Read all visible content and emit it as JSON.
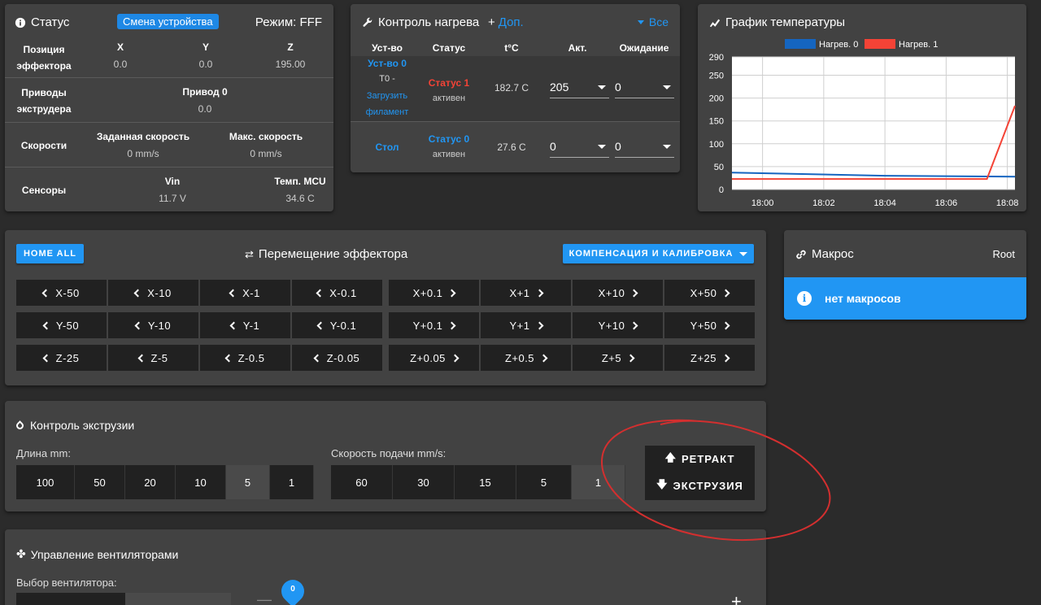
{
  "status": {
    "title": "Статус",
    "device_change": "Смена устройства",
    "mode": "Режим: FFF",
    "position_label_1": "Позиция",
    "position_label_2": "эффектора",
    "axes": [
      {
        "name": "X",
        "value": "0.0"
      },
      {
        "name": "Y",
        "value": "0.0"
      },
      {
        "name": "Z",
        "value": "195.00"
      }
    ],
    "drives_label_1": "Приводы",
    "drives_label_2": "экструдера",
    "drive0_name": "Привод 0",
    "drive0_value": "0.0",
    "speeds_label": "Скорости",
    "req_speed_name": "Заданная скорость",
    "req_speed_value": "0 mm/s",
    "max_speed_name": "Макс. скорость",
    "max_speed_value": "0 mm/s",
    "sensors_label": "Сенсоры",
    "vin_name": "Vin",
    "vin_value": "11.7 V",
    "mcu_name": "Темп. MCU",
    "mcu_value": "34.6 C"
  },
  "heater": {
    "title": "Контроль нагрева",
    "extra": "Доп.",
    "all": "Все",
    "columns": [
      "Уст-во",
      "Статус",
      "t°C",
      "Акт.",
      "Ожидание"
    ],
    "tool": {
      "name": "Уст-во 0",
      "sub": "T0 -",
      "load_1": "Загрузить",
      "load_2": "филамент",
      "status": "Статус 1",
      "state": "активен",
      "temp": "182.7 C",
      "active": "205",
      "standby": "0"
    },
    "bed": {
      "name": "Стол",
      "status": "Статус 0",
      "state": "активен",
      "temp": "27.6 C",
      "active": "0",
      "standby": "0"
    }
  },
  "graph": {
    "title": "График температуры"
  },
  "chart_data": {
    "type": "line",
    "title": "",
    "xlabel": "",
    "ylabel": "",
    "x_ticks": [
      "18:00",
      "18:02",
      "18:04",
      "18:06",
      "18:08"
    ],
    "y_ticks": [
      0,
      50,
      100,
      150,
      200,
      250,
      290
    ],
    "ylim": [
      0,
      290
    ],
    "xlim": [
      "17:59:00",
      "18:08:15"
    ],
    "grid": true,
    "legend_position": "top-center",
    "series": [
      {
        "name": "Нагрев. 0",
        "color": "#1565c0",
        "x": [
          "17:59:00",
          "18:04:00",
          "18:08:15"
        ],
        "y": [
          37,
          30,
          28
        ]
      },
      {
        "name": "Нагрев. 1",
        "color": "#f44336",
        "x": [
          "17:59:00",
          "18:07:20",
          "18:08:15"
        ],
        "y": [
          23,
          23,
          183
        ]
      }
    ]
  },
  "move": {
    "home_all": "HOME ALL",
    "title": "Перемещение эффектора",
    "compensation": "КОМПЕНСАЦИЯ И КАЛИБРОВКА",
    "rows": [
      {
        "neg": [
          "X-50",
          "X-10",
          "X-1",
          "X-0.1"
        ],
        "pos": [
          "X+0.1",
          "X+1",
          "X+10",
          "X+50"
        ]
      },
      {
        "neg": [
          "Y-50",
          "Y-10",
          "Y-1",
          "Y-0.1"
        ],
        "pos": [
          "Y+0.1",
          "Y+1",
          "Y+10",
          "Y+50"
        ]
      },
      {
        "neg": [
          "Z-25",
          "Z-5",
          "Z-0.5",
          "Z-0.05"
        ],
        "pos": [
          "Z+0.05",
          "Z+0.5",
          "Z+5",
          "Z+25"
        ]
      }
    ]
  },
  "macros": {
    "title": "Макрос",
    "root": "Root",
    "empty": "нет макросов"
  },
  "extrusion": {
    "title": "Контроль экструзии",
    "length_label": "Длина mm:",
    "lengths": [
      "100",
      "50",
      "20",
      "10",
      "5",
      "1"
    ],
    "length_selected": "5",
    "feed_label": "Скорость подачи mm/s:",
    "feeds": [
      "60",
      "30",
      "15",
      "5",
      "1"
    ],
    "feed_selected": "1",
    "retract": "РЕТРАКТ",
    "extrude": "ЭКСТРУЗИЯ"
  },
  "fans": {
    "title": "Управление вентиляторами",
    "select_label": "Выбор вентилятора:",
    "value": "0",
    "minus": "—",
    "plus": "+"
  },
  "annotation_color": "#d32f2f"
}
